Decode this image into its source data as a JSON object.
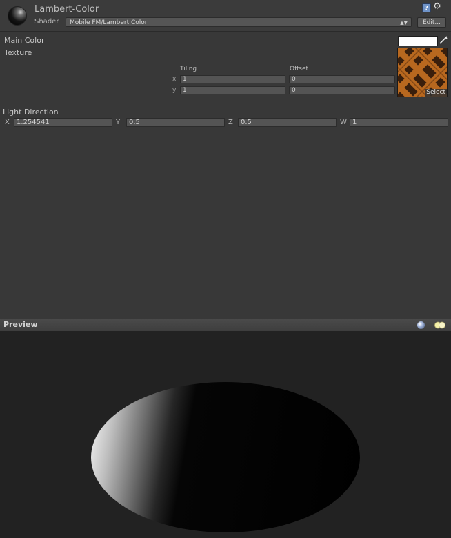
{
  "header": {
    "title": "Lambert-Color",
    "shader_label": "Shader",
    "shader_value": "Mobile FM/Lambert Color",
    "edit_label": "Edit...",
    "help_icon": "help-book-icon",
    "settings_icon": "gear-icon"
  },
  "properties": {
    "main_color_label": "Main Color",
    "main_color_value": "#ffffff",
    "texture_label": "Texture",
    "tiling_label": "Tiling",
    "offset_label": "Offset",
    "x_axis": "x",
    "y_axis": "y",
    "tiling_x": "1",
    "tiling_y": "1",
    "offset_x": "0",
    "offset_y": "0",
    "select_label": "Select"
  },
  "light_direction": {
    "label": "Light Direction",
    "x_label": "X",
    "x_value": "1.254541",
    "y_label": "Y",
    "y_value": "0.5",
    "z_label": "Z",
    "z_value": "0.5",
    "w_label": "W",
    "w_value": "1"
  },
  "preview": {
    "title": "Preview",
    "sphere_icon": "preview-sphere-icon",
    "lights_icon": "preview-lights-icon"
  }
}
